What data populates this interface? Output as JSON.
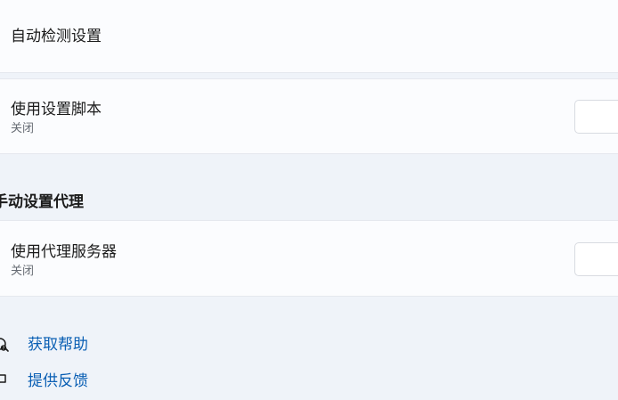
{
  "auto_detect": {
    "title": "自动检测设置"
  },
  "setup_script": {
    "title": "使用设置脚本",
    "status": "关闭"
  },
  "manual_section": {
    "heading": "手动设置代理"
  },
  "proxy_server": {
    "title": "使用代理服务器",
    "status": "关闭"
  },
  "links": {
    "help": "获取帮助",
    "feedback": "提供反馈"
  },
  "icons": {
    "help": "help-chat-icon",
    "feedback": "feedback-icon"
  },
  "colors": {
    "link": "#0a5fb4",
    "page_background": "#eff3f9",
    "card_background": "#fbfcfe"
  }
}
